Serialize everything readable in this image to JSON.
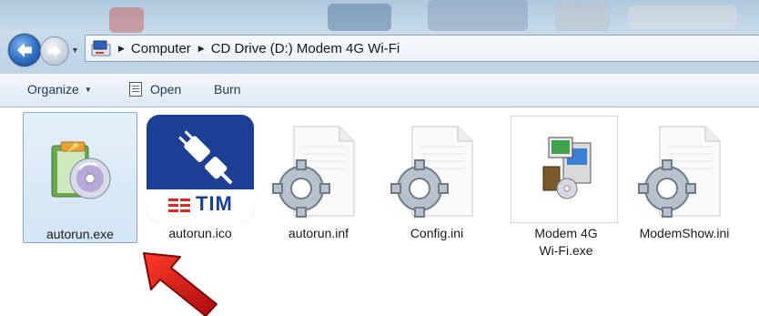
{
  "address": {
    "crumbs": [
      "Computer",
      "CD Drive (D:) Modem 4G Wi-Fi"
    ]
  },
  "toolbar": {
    "organize_label": "Organize",
    "open_label": "Open",
    "burn_label": "Burn"
  },
  "files": [
    {
      "name": "autorun.exe",
      "icon": "installer-disc-icon",
      "selected": true
    },
    {
      "name": "autorun.ico",
      "icon": "tim-plug-icon",
      "brand": "TIM"
    },
    {
      "name": "autorun.inf",
      "icon": "settings-file-icon"
    },
    {
      "name": "Config.ini",
      "icon": "settings-file-icon"
    },
    {
      "name_line1": "Modem 4G",
      "name_line2": "Wi-Fi.exe",
      "icon": "setup-computer-icon"
    },
    {
      "name": "ModemShow.ini",
      "icon": "settings-file-icon"
    }
  ],
  "colors": {
    "tim_blue": "#1c3f94",
    "tim_red": "#e2251b",
    "selection": "#d3e5f6",
    "arrow_red": "#cc1414"
  }
}
